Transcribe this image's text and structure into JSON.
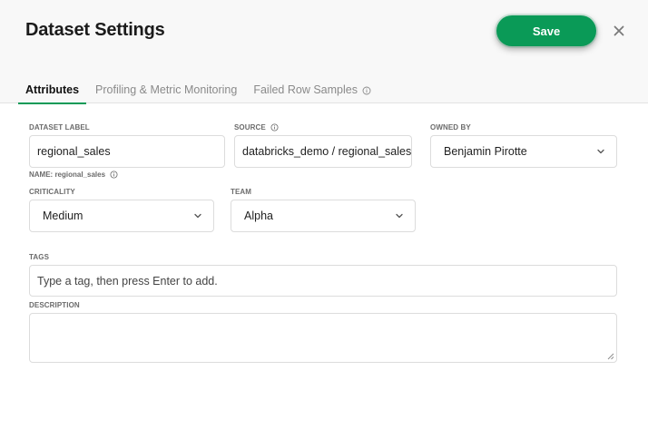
{
  "header": {
    "title": "Dataset Settings",
    "save_label": "Save",
    "close_icon": "close-icon"
  },
  "tabs": [
    {
      "label": "Attributes",
      "active": true
    },
    {
      "label": "Profiling & Metric Monitoring",
      "active": false
    },
    {
      "label": "Failed Row Samples",
      "active": false,
      "icon": "info-icon"
    }
  ],
  "form": {
    "dataset_label": {
      "label": "DATASET LABEL",
      "value": "regional_sales"
    },
    "name_note": "NAME: regional_sales",
    "source": {
      "label": "SOURCE",
      "value": "databricks_demo / regional_sales"
    },
    "owned_by": {
      "label": "OWNED BY",
      "value": "Benjamin Pirotte"
    },
    "criticality": {
      "label": "CRITICALITY",
      "value": "Medium"
    },
    "team": {
      "label": "TEAM",
      "value": "Alpha"
    },
    "tags": {
      "label": "TAGS",
      "placeholder": "Type a tag, then press Enter to add."
    },
    "description": {
      "label": "DESCRIPTION",
      "value": ""
    }
  },
  "colors": {
    "accent": "#0a9a57",
    "header_bg": "#f8f8f8",
    "border": "#dcdcdc"
  }
}
